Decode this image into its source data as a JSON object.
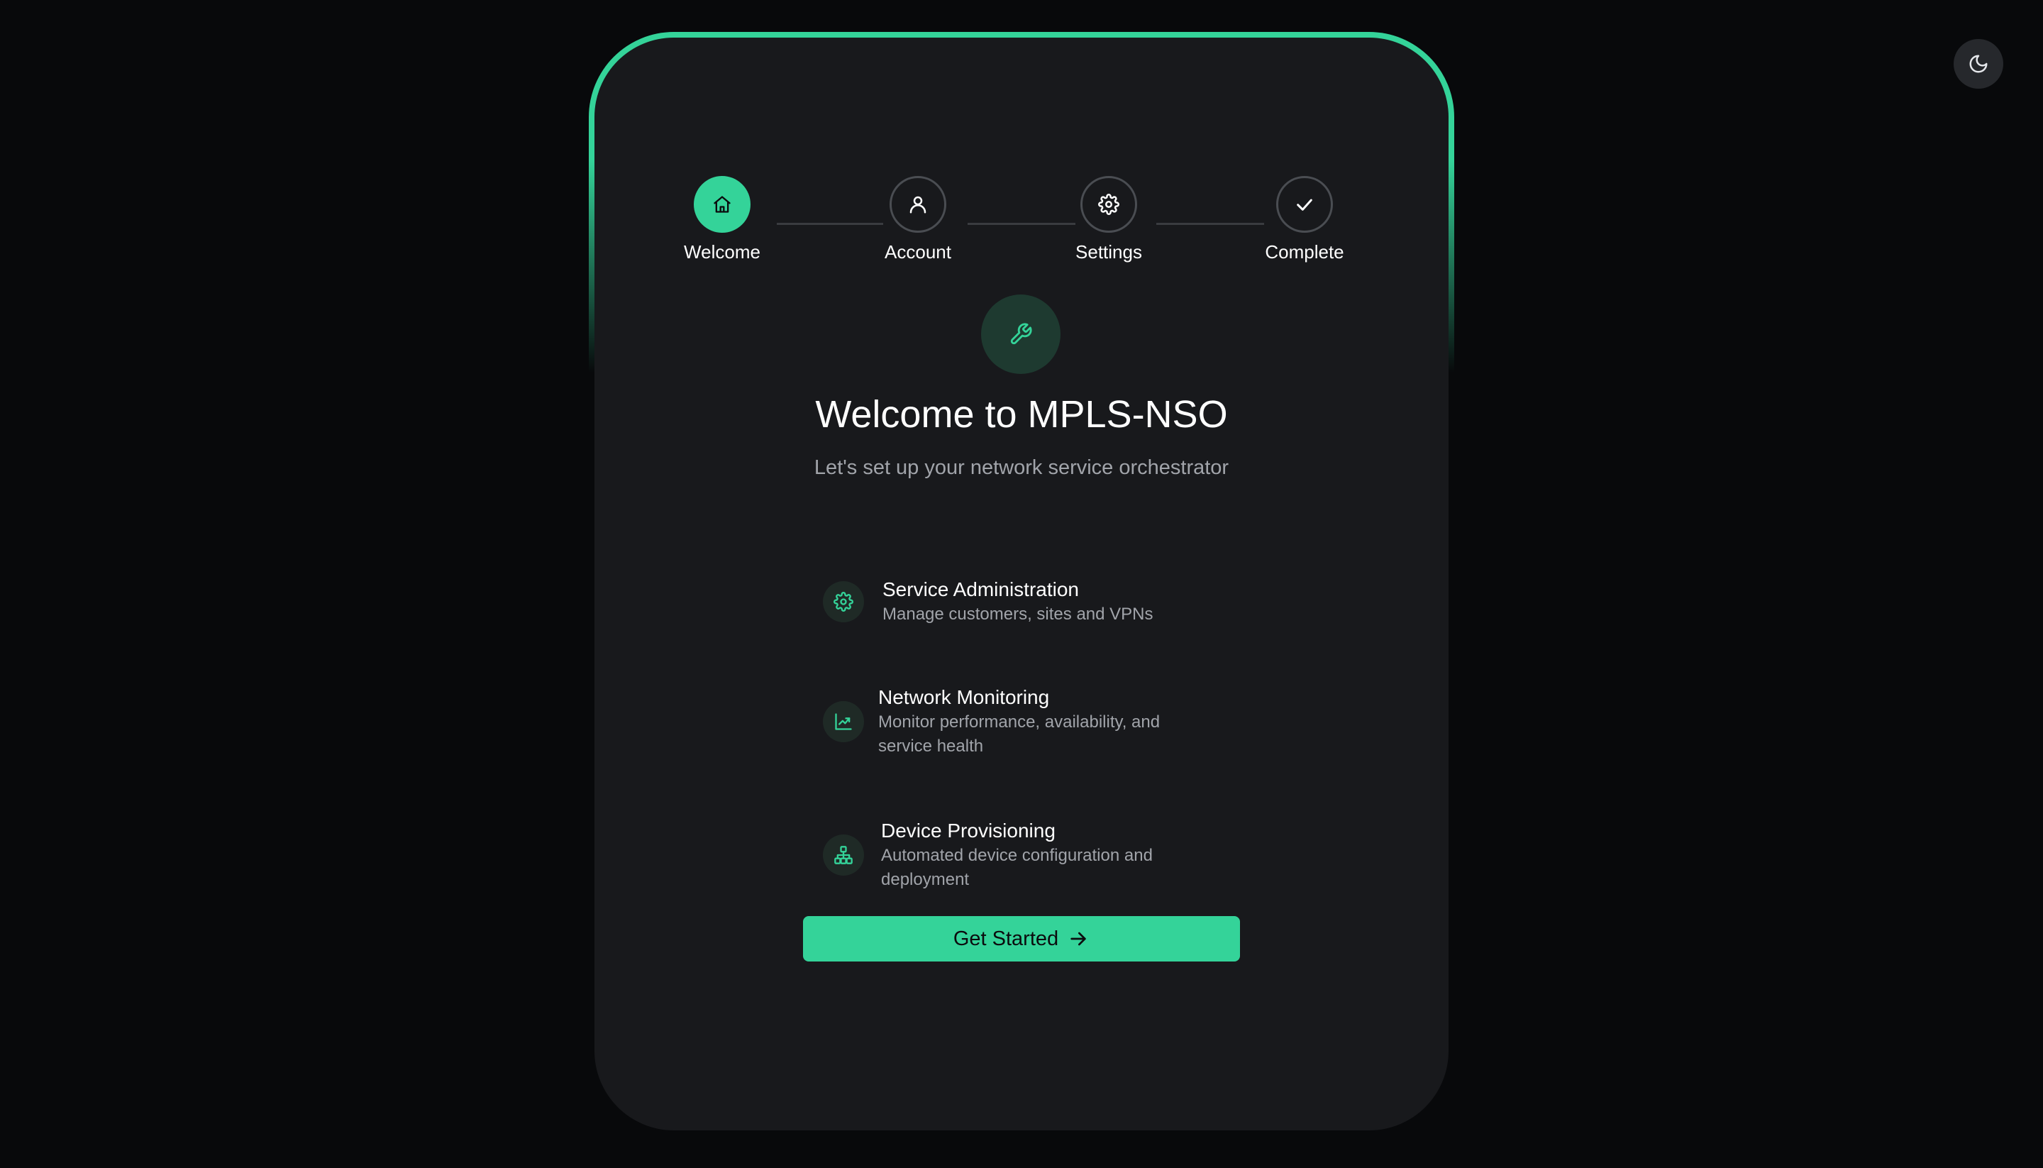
{
  "colors": {
    "accent": "#34d399",
    "background": "#08090b",
    "card": "#18191c",
    "muted_text": "#a1a4aa"
  },
  "theme_toggle": {
    "icon": "moon-icon"
  },
  "stepper": {
    "steps": [
      {
        "label": "Welcome",
        "icon": "home-icon",
        "active": true
      },
      {
        "label": "Account",
        "icon": "user-icon",
        "active": false
      },
      {
        "label": "Settings",
        "icon": "gear-icon",
        "active": false
      },
      {
        "label": "Complete",
        "icon": "check-icon",
        "active": false
      }
    ]
  },
  "hero": {
    "icon": "wrench-icon",
    "title": "Welcome to MPLS-NSO",
    "subtitle": "Let's set up your network service orchestrator"
  },
  "features": [
    {
      "icon": "gear-icon",
      "title": "Service Administration",
      "description": "Manage customers, sites and VPNs"
    },
    {
      "icon": "chart-icon",
      "title": "Network Monitoring",
      "description": "Monitor performance, availability, and service health"
    },
    {
      "icon": "network-icon",
      "title": "Device Provisioning",
      "description": "Automated device configuration and deployment"
    }
  ],
  "cta": {
    "label": "Get Started",
    "icon": "arrow-right-icon"
  }
}
